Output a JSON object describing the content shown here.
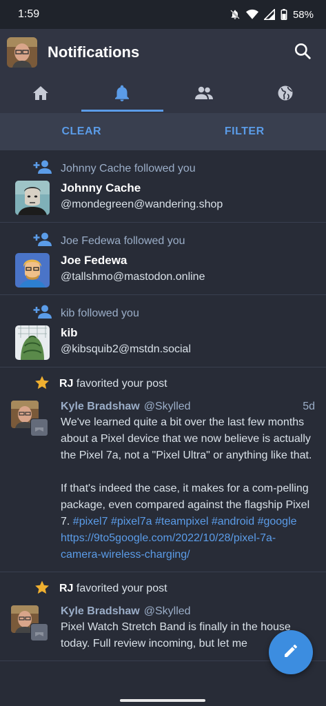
{
  "status_bar": {
    "time": "1:59",
    "battery": "58%"
  },
  "app_bar": {
    "title": "Notifications"
  },
  "tabs": [
    {
      "icon": "home-icon"
    },
    {
      "icon": "bell-icon",
      "active": true
    },
    {
      "icon": "people-icon"
    },
    {
      "icon": "globe-icon"
    }
  ],
  "actions": {
    "clear": "CLEAR",
    "filter": "FILTER"
  },
  "notifications": [
    {
      "type": "follow",
      "text": "Johnny Cache followed you",
      "name": "Johnny Cache",
      "handle": "@mondegreen@wandering.shop"
    },
    {
      "type": "follow",
      "text": "Joe Fedewa followed you",
      "name": "Joe Fedewa",
      "handle": "@tallshmo@mastodon.online"
    },
    {
      "type": "follow",
      "text": "kib followed you",
      "name": "kib",
      "handle": "@kibsquib2@mstdn.social"
    },
    {
      "type": "favorite",
      "actor": "RJ",
      "action": "favorited your post",
      "author": "Kyle Bradshaw",
      "author_handle": "@Skylled",
      "time": "5d",
      "para1": "We've learned quite a bit over the last few months about a Pixel device that we now believe is actually the Pixel 7a, not a \"Pixel Ultra\" or anything like that.",
      "para2_text": "If that's indeed the case, it makes for a com-pelling package, even compared against the flagship Pixel 7. ",
      "tags": [
        "#pixel7",
        "#pixel7a",
        "#teampixel",
        "#android",
        "#google"
      ],
      "link": "https://9to5google.com/2022/10/28/pixel-7a-camera-wireless-charging/"
    },
    {
      "type": "favorite",
      "actor": "RJ",
      "action": "favorited your post",
      "author": "Kyle Bradshaw",
      "author_handle": "@Skylled",
      "body": "Pixel Watch Stretch Band is finally in the house today. Full review incoming, but let me"
    }
  ],
  "colors": {
    "accent": "#5b9ce8",
    "background": "#282c37",
    "bar": "#313543"
  }
}
